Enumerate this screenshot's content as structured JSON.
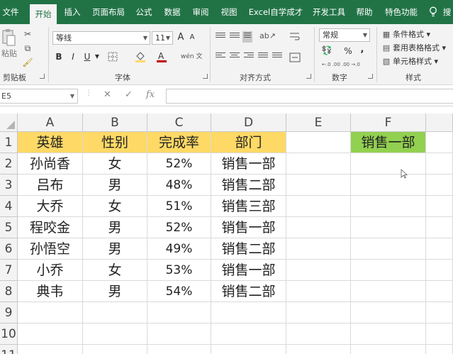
{
  "ribbon_tabs": [
    "文件",
    "开始",
    "插入",
    "页面布局",
    "公式",
    "数据",
    "审阅",
    "视图",
    "Excel自学成才",
    "开发工具",
    "帮助",
    "特色功能",
    "搜"
  ],
  "active_tab": "开始",
  "clipboard": {
    "paste_label": "粘贴",
    "group_label": "剪贴板"
  },
  "font": {
    "name": "等线",
    "size": "11",
    "grow": "A",
    "shrink": "A",
    "bold": "B",
    "italic": "I",
    "underline": "U",
    "group_label": "字体",
    "wen": "wén 文"
  },
  "alignment": {
    "group_label": "对齐方式"
  },
  "number": {
    "format": "常规",
    "percent": "%",
    "comma": ",",
    "inc_decimal": "←.0 .00",
    "dec_decimal": ".00 →.0",
    "group_label": "数字"
  },
  "styles": {
    "conditional": "条件格式",
    "table": "套用表格格式",
    "cell": "单元格样式",
    "group_label": "样式"
  },
  "formula_bar": {
    "name_box": "E5",
    "fx": "fx",
    "value": ""
  },
  "columns": [
    "A",
    "B",
    "C",
    "D",
    "E",
    "F"
  ],
  "rows": [
    "1",
    "2",
    "3",
    "4",
    "5",
    "6",
    "7",
    "8",
    "9",
    "10",
    "11"
  ],
  "table": {
    "headers": [
      "英雄",
      "性别",
      "完成率",
      "部门"
    ],
    "rows": [
      [
        "孙尚香",
        "女",
        "52%",
        "销售一部"
      ],
      [
        "吕布",
        "男",
        "48%",
        "销售二部"
      ],
      [
        "大乔",
        "女",
        "51%",
        "销售三部"
      ],
      [
        "程咬金",
        "男",
        "52%",
        "销售一部"
      ],
      [
        "孙悟空",
        "男",
        "49%",
        "销售二部"
      ],
      [
        "小乔",
        "女",
        "53%",
        "销售一部"
      ],
      [
        "典韦",
        "男",
        "54%",
        "销售二部"
      ]
    ]
  },
  "f1_value": "销售一部",
  "colors": {
    "ribbon": "#217346",
    "header_fill": "#ffd966",
    "f1_fill": "#92d050"
  }
}
